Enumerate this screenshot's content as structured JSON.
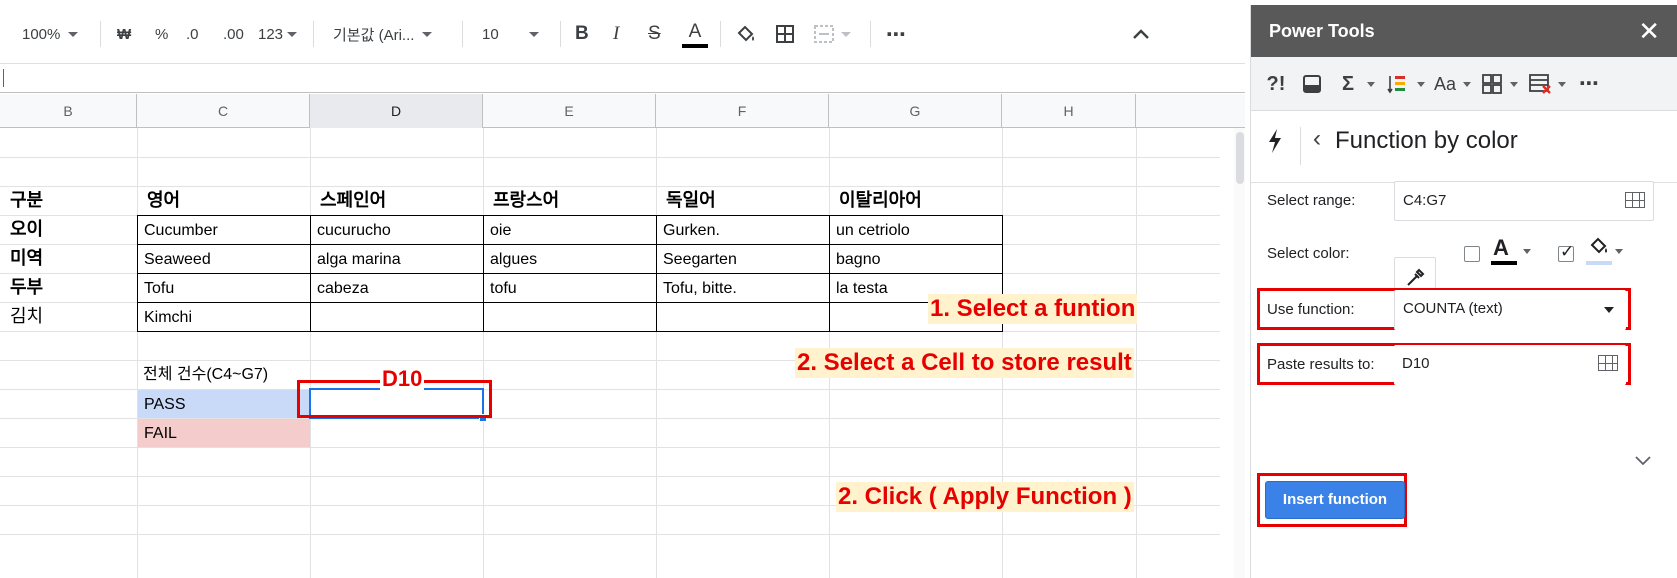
{
  "toolbar": {
    "zoom": "100%",
    "currency": "₩",
    "percent": "%",
    "decrease_decimal": ".0",
    "increase_decimal": ".00",
    "number_format": "123",
    "font": "기본값 (Ari...",
    "font_size": "10",
    "bold": "B",
    "italic": "I",
    "strike": "S",
    "text_color": "A",
    "more": "⋯",
    "collapse": "^"
  },
  "columns": [
    "B",
    "C",
    "D",
    "E",
    "F",
    "G",
    "H"
  ],
  "table": {
    "header": [
      "구분",
      "영어",
      "스페인어",
      "프랑스어",
      "독일어",
      "이탈리아어"
    ],
    "rows": [
      [
        "오이",
        "Cucumber",
        "cucurucho",
        "oie",
        "Gurken.",
        "un cetriolo"
      ],
      [
        "미역",
        "Seaweed",
        "alga marina",
        "algues",
        "Seegarten",
        "bagno"
      ],
      [
        "두부",
        "Tofu",
        "cabeza",
        "tofu",
        "Tofu, bitte.",
        "la testa"
      ],
      [
        "김치",
        "Kimchi",
        "",
        "",
        "",
        ""
      ]
    ]
  },
  "summary": {
    "title": "전체 건수(C4~G7)",
    "pass": "PASS",
    "fail": "FAIL"
  },
  "annotations": {
    "cell_label": "D10",
    "step1": "1. Select a funtion",
    "step2": "2. Select a Cell to store result",
    "step3": "2. Click ( Apply Function )"
  },
  "panel": {
    "title": "Power Tools",
    "close": "✕",
    "section_title": "Function by color",
    "select_range_label": "Select range:",
    "select_range_value": "C4:G7",
    "select_color_label": "Select color:",
    "use_function_label": "Use function:",
    "use_function_value": "COUNTA (text)",
    "paste_results_label": "Paste results to:",
    "paste_results_value": "D10",
    "insert_button": "Insert function"
  },
  "colors": {
    "pass_fill": "#c9daf8",
    "fail_fill": "#f4cccc",
    "annotation_red": "#e60000",
    "callout_bg": "#fff2cc",
    "button_blue": "#3b82e8",
    "panel_title_bg": "#595959"
  }
}
